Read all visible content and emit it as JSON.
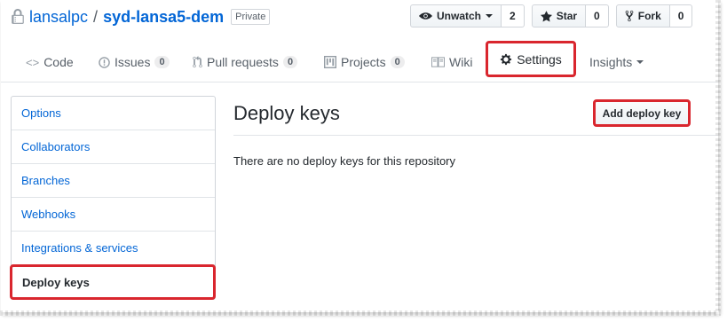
{
  "repo": {
    "owner": "lansalpc",
    "separator": "/",
    "name": "syd-lansa5-dem",
    "visibility_badge": "Private",
    "icon": "repo-lock-icon"
  },
  "actions": {
    "watch": {
      "label": "Unwatch",
      "count": "2",
      "icon": "eye-icon"
    },
    "star": {
      "label": "Star",
      "count": "0",
      "icon": "star-icon"
    },
    "fork": {
      "label": "Fork",
      "count": "0",
      "icon": "fork-icon"
    }
  },
  "tabs": [
    {
      "label": "Code",
      "icon": "code-icon",
      "counter": ""
    },
    {
      "label": "Issues",
      "icon": "issue-icon",
      "counter": "0"
    },
    {
      "label": "Pull requests",
      "icon": "pull-request-icon",
      "counter": "0"
    },
    {
      "label": "Projects",
      "icon": "project-icon",
      "counter": "0"
    },
    {
      "label": "Wiki",
      "icon": "book-icon",
      "counter": ""
    },
    {
      "label": "Settings",
      "icon": "gear-icon",
      "counter": ""
    },
    {
      "label": "Insights",
      "icon": "caret-down-icon",
      "counter": ""
    }
  ],
  "sidebar": {
    "items": [
      {
        "label": "Options"
      },
      {
        "label": "Collaborators"
      },
      {
        "label": "Branches"
      },
      {
        "label": "Webhooks"
      },
      {
        "label": "Integrations & services"
      },
      {
        "label": "Deploy keys"
      }
    ]
  },
  "main": {
    "title": "Deploy keys",
    "add_button": "Add deploy key",
    "empty_message": "There are no deploy keys for this repository"
  },
  "colors": {
    "link": "#0366d6",
    "highlight": "#d9262e",
    "text": "#24292e",
    "muted": "#586069"
  }
}
